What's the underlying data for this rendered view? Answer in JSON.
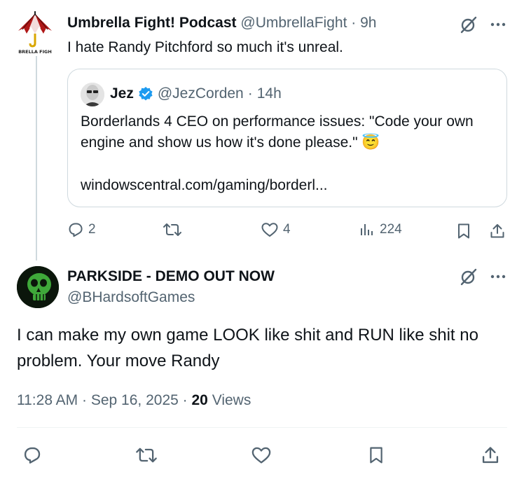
{
  "parent_tweet": {
    "display_name": "Umbrella Fight! Podcast",
    "handle": "@UmbrellaFight",
    "separator": "·",
    "time": "9h",
    "avatar_text": "BRELLA FIGH",
    "text": "I hate Randy Pitchford so much it's unreal.",
    "quote": {
      "display_name": "Jez",
      "handle": "@JezCorden",
      "separator": "·",
      "time": "14h",
      "text": "Borderlands 4 CEO on performance issues: \"Code your own engine and show us how it's done please.\" 😇",
      "link": "windowscentral.com/gaming/borderl..."
    },
    "actions": {
      "replies": "2",
      "retweets": "",
      "likes": "4",
      "views": "224"
    }
  },
  "reply_tweet": {
    "display_name": "PARKSIDE - DEMO OUT NOW",
    "handle": "@BHardsoftGames",
    "text": "I can make my own game LOOK like shit and RUN like shit no problem. Your move Randy",
    "time": "11:28 AM",
    "sep1": "·",
    "date": "Sep 16, 2025",
    "sep2": "·",
    "view_count": "20",
    "views_label": "Views"
  },
  "colors": {
    "text": "#0f1419",
    "muted": "#536471",
    "border": "#cfd9de",
    "verified": "#1d9bf0"
  },
  "icons": [
    "grok-icon",
    "more-icon",
    "verified-badge-icon",
    "reply-icon",
    "retweet-icon",
    "like-icon",
    "views-icon",
    "bookmark-icon",
    "share-icon"
  ]
}
